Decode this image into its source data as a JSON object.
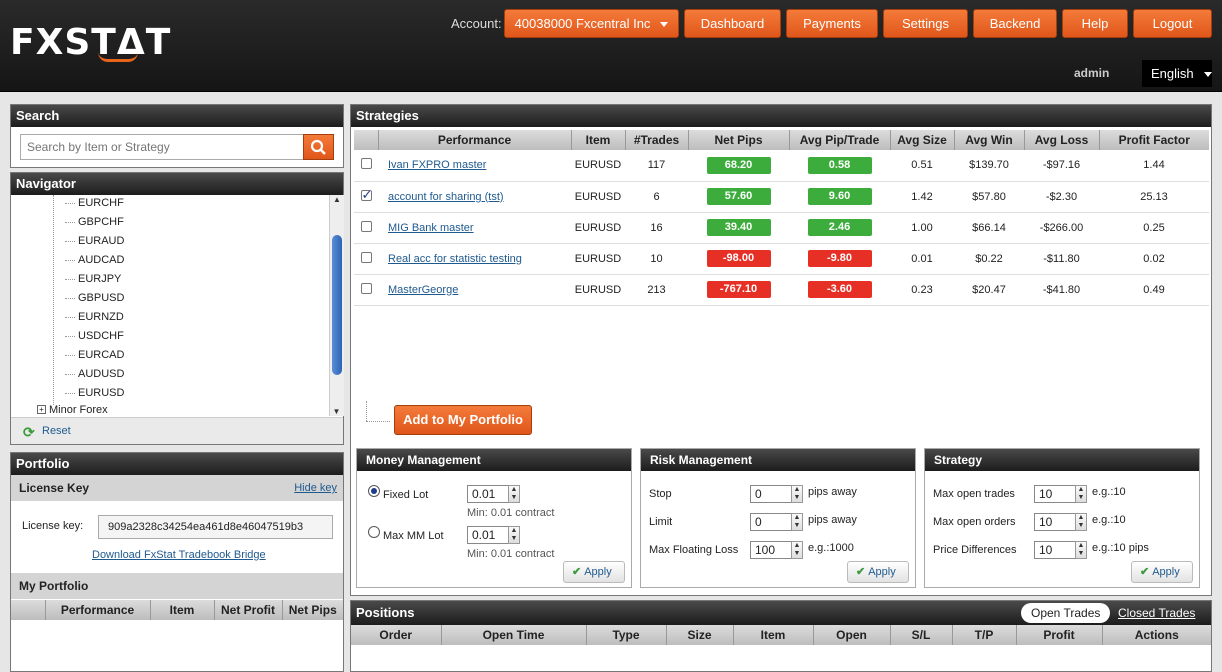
{
  "brand": {
    "logo": "FXSTΔT"
  },
  "header": {
    "account_label": "Account:",
    "account_value": "40038000 Fxcentral Inc",
    "nav": [
      "Dashboard",
      "Payments",
      "Settings",
      "Backend",
      "Help",
      "Logout"
    ],
    "user": "admin",
    "language": "English"
  },
  "search": {
    "title": "Search",
    "placeholder": "Search by Item or Strategy"
  },
  "navigator": {
    "title": "Navigator",
    "items": [
      "EURCHF",
      "GBPCHF",
      "EURAUD",
      "AUDCAD",
      "EURJPY",
      "GBPUSD",
      "EURNZD",
      "USDCHF",
      "EURCAD",
      "AUDUSD",
      "EURUSD"
    ],
    "group": "Minor Forex",
    "reset": "Reset"
  },
  "portfolio": {
    "title": "Portfolio",
    "license_section": "License Key",
    "hide_key": "Hide key",
    "license_label": "License key:",
    "license_value": "909a2328c34254ea461d8e46047519b3",
    "download_link": "Download FxStat Tradebook Bridge",
    "my_portfolio": "My Portfolio",
    "columns": [
      "Performance",
      "Item",
      "Net Profit",
      "Net Pips"
    ]
  },
  "strategies": {
    "title": "Strategies",
    "columns": [
      "Performance",
      "Item",
      "#Trades",
      "Net Pips",
      "Avg Pip/Trade",
      "Avg Size",
      "Avg Win",
      "Avg Loss",
      "Profit Factor"
    ],
    "rows": [
      {
        "checked": false,
        "name": "Ivan FXPRO master",
        "item": "EURUSD",
        "trades": "117",
        "net_pips": "68.20",
        "net_pips_sign": "pos",
        "avg_pip": "0.58",
        "avg_pip_sign": "pos",
        "avg_size": "0.51",
        "avg_win": "$139.70",
        "avg_loss": "-$97.16",
        "profit_factor": "1.44"
      },
      {
        "checked": true,
        "name": "account for sharing (tst)",
        "item": "EURUSD",
        "trades": "6",
        "net_pips": "57.60",
        "net_pips_sign": "pos",
        "avg_pip": "9.60",
        "avg_pip_sign": "pos",
        "avg_size": "1.42",
        "avg_win": "$57.80",
        "avg_loss": "-$2.30",
        "profit_factor": "25.13"
      },
      {
        "checked": false,
        "name": "MIG Bank master",
        "item": "EURUSD",
        "trades": "16",
        "net_pips": "39.40",
        "net_pips_sign": "pos",
        "avg_pip": "2.46",
        "avg_pip_sign": "pos",
        "avg_size": "1.00",
        "avg_win": "$66.14",
        "avg_loss": "-$266.00",
        "profit_factor": "0.25"
      },
      {
        "checked": false,
        "name": "Real acc for statistic testing",
        "item": "EURUSD",
        "trades": "10",
        "net_pips": "-98.00",
        "net_pips_sign": "neg",
        "avg_pip": "-9.80",
        "avg_pip_sign": "neg",
        "avg_size": "0.01",
        "avg_win": "$0.22",
        "avg_loss": "-$11.80",
        "profit_factor": "0.02"
      },
      {
        "checked": false,
        "name": "MasterGeorge",
        "item": "EURUSD",
        "trades": "213",
        "net_pips": "-767.10",
        "net_pips_sign": "neg",
        "avg_pip": "-3.60",
        "avg_pip_sign": "neg",
        "avg_size": "0.23",
        "avg_win": "$20.47",
        "avg_loss": "-$41.80",
        "profit_factor": "0.49"
      }
    ],
    "add_button": "Add to My Portfolio"
  },
  "money": {
    "title": "Money Management",
    "fixed_lot_label": "Fixed Lot",
    "fixed_lot_value": "0.01",
    "fixed_lot_hint": "Min: 0.01 contract",
    "maxmm_label": "Max MM Lot",
    "maxmm_value": "0.01",
    "maxmm_hint": "Min: 0.01 contract",
    "selected": "Fixed Lot",
    "apply": "Apply"
  },
  "risk": {
    "title": "Risk Management",
    "stop_label": "Stop",
    "stop_value": "0",
    "stop_hint": "pips away",
    "limit_label": "Limit",
    "limit_value": "0",
    "limit_hint": "pips away",
    "floating_label": "Max Floating Loss",
    "floating_value": "100",
    "floating_hint": "e.g.:1000",
    "apply": "Apply"
  },
  "strategy": {
    "title": "Strategy",
    "trades_label": "Max open trades",
    "trades_value": "10",
    "trades_hint": "e.g.:10",
    "orders_label": "Max open orders",
    "orders_value": "10",
    "orders_hint": "e.g.:10",
    "price_label": "Price Differences",
    "price_value": "10",
    "price_hint": "e.g.:10 pips",
    "apply": "Apply"
  },
  "positions": {
    "title": "Positions",
    "tabs": [
      "Open Trades",
      "Closed Trades"
    ],
    "active_tab": "Open Trades",
    "columns": [
      "Order",
      "Open Time",
      "Type",
      "Size",
      "Item",
      "Open",
      "S/L",
      "T/P",
      "Profit",
      "Actions"
    ]
  },
  "colors": {
    "accent": "#ee6a2c",
    "positive": "#3cac3c",
    "negative": "#e63026",
    "link": "#1f5a8f"
  }
}
